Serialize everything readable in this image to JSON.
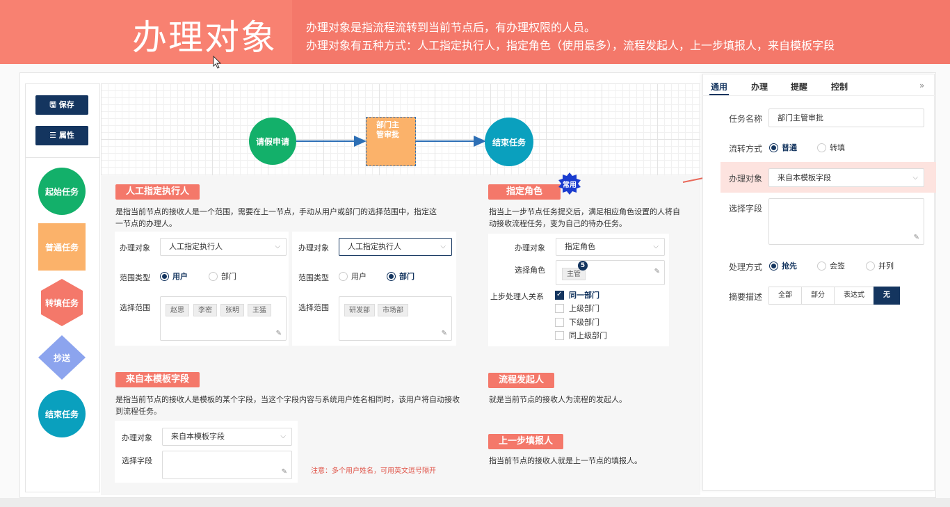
{
  "banner": {
    "title": "办理对象",
    "line1": "办理对象是指流程流转到当前节点后，有办理权限的人员。",
    "line2": "办理对象有五种方式：人工指定执行人，指定角色（使用最多），流程发起人，上一步填报人，来自模板字段"
  },
  "toolbar": {
    "save_label": "保存",
    "props_label": "属性"
  },
  "palette": {
    "start": "起始任务",
    "normal": "普通任务",
    "transfer": "转填任务",
    "cc": "抄送",
    "end": "结束任务"
  },
  "flow": {
    "node1": "请假申请",
    "node2": "部门主管审批",
    "node3": "结束任务"
  },
  "manual": {
    "tag": "人工指定执行人",
    "desc": "是指当前节点的接收人是一个范围，需要在上一节点，手动从用户或部门的选择范围中，指定这一节点的办理人。",
    "obj_label": "办理对象",
    "obj_value": "人工指定执行人",
    "scope_type_label": "范围类型",
    "opt_user": "用户",
    "opt_dept": "部门",
    "scope_label": "选择范围",
    "users": [
      "赵思",
      "李密",
      "张明",
      "王猛"
    ],
    "depts": [
      "研发部",
      "市场部"
    ]
  },
  "role": {
    "tag": "指定角色",
    "badge": "常用",
    "desc": "指当上一步节点任务提交后，满足相应角色设置的人将自动接收流程任务，变为自己的待办任务。",
    "obj_label": "办理对象",
    "obj_value": "指定角色",
    "role_label": "选择角色",
    "role_chip": "主管",
    "role_count": "5",
    "relation_label": "上步处理人关系",
    "relations": [
      "同一部门",
      "上级部门",
      "下级部门",
      "同上级部门"
    ]
  },
  "template": {
    "tag": "来自本模板字段",
    "desc": "是指当前节点的接收人是模板的某个字段，当这个字段内容与系统用户姓名相同时，该用户将自动接收到流程任务。",
    "obj_label": "办理对象",
    "obj_value": "来自本模板字段",
    "field_label": "选择字段",
    "note": "注意：多个用户姓名，可用英文逗号隔开"
  },
  "initiator": {
    "tag": "流程发起人",
    "desc": "就是当前节点的接收人为流程的发起人。"
  },
  "prevstep": {
    "tag": "上一步填报人",
    "desc": "指当前节点的接收人就是上一节点的填报人。"
  },
  "panel": {
    "tabs": [
      "通用",
      "办理",
      "提醒",
      "控制"
    ],
    "collapse": "»",
    "task_name_label": "任务名称",
    "task_name_value": "部门主管审批",
    "flow_mode_label": "流转方式",
    "flow_mode_opts": [
      "普通",
      "转填"
    ],
    "obj_label": "办理对象",
    "obj_value": "来自本模板字段",
    "field_label": "选择字段",
    "handle_label": "处理方式",
    "handle_opts": [
      "抢先",
      "会签",
      "并列"
    ],
    "summary_label": "摘要描述",
    "summary_opts": [
      "全部",
      "部分",
      "表达式",
      "无"
    ]
  },
  "colors": {
    "accent": "#f4786a",
    "navy": "#14355f",
    "green": "#13b06a",
    "orange": "#fbb26a",
    "teal": "#0aa0be"
  }
}
